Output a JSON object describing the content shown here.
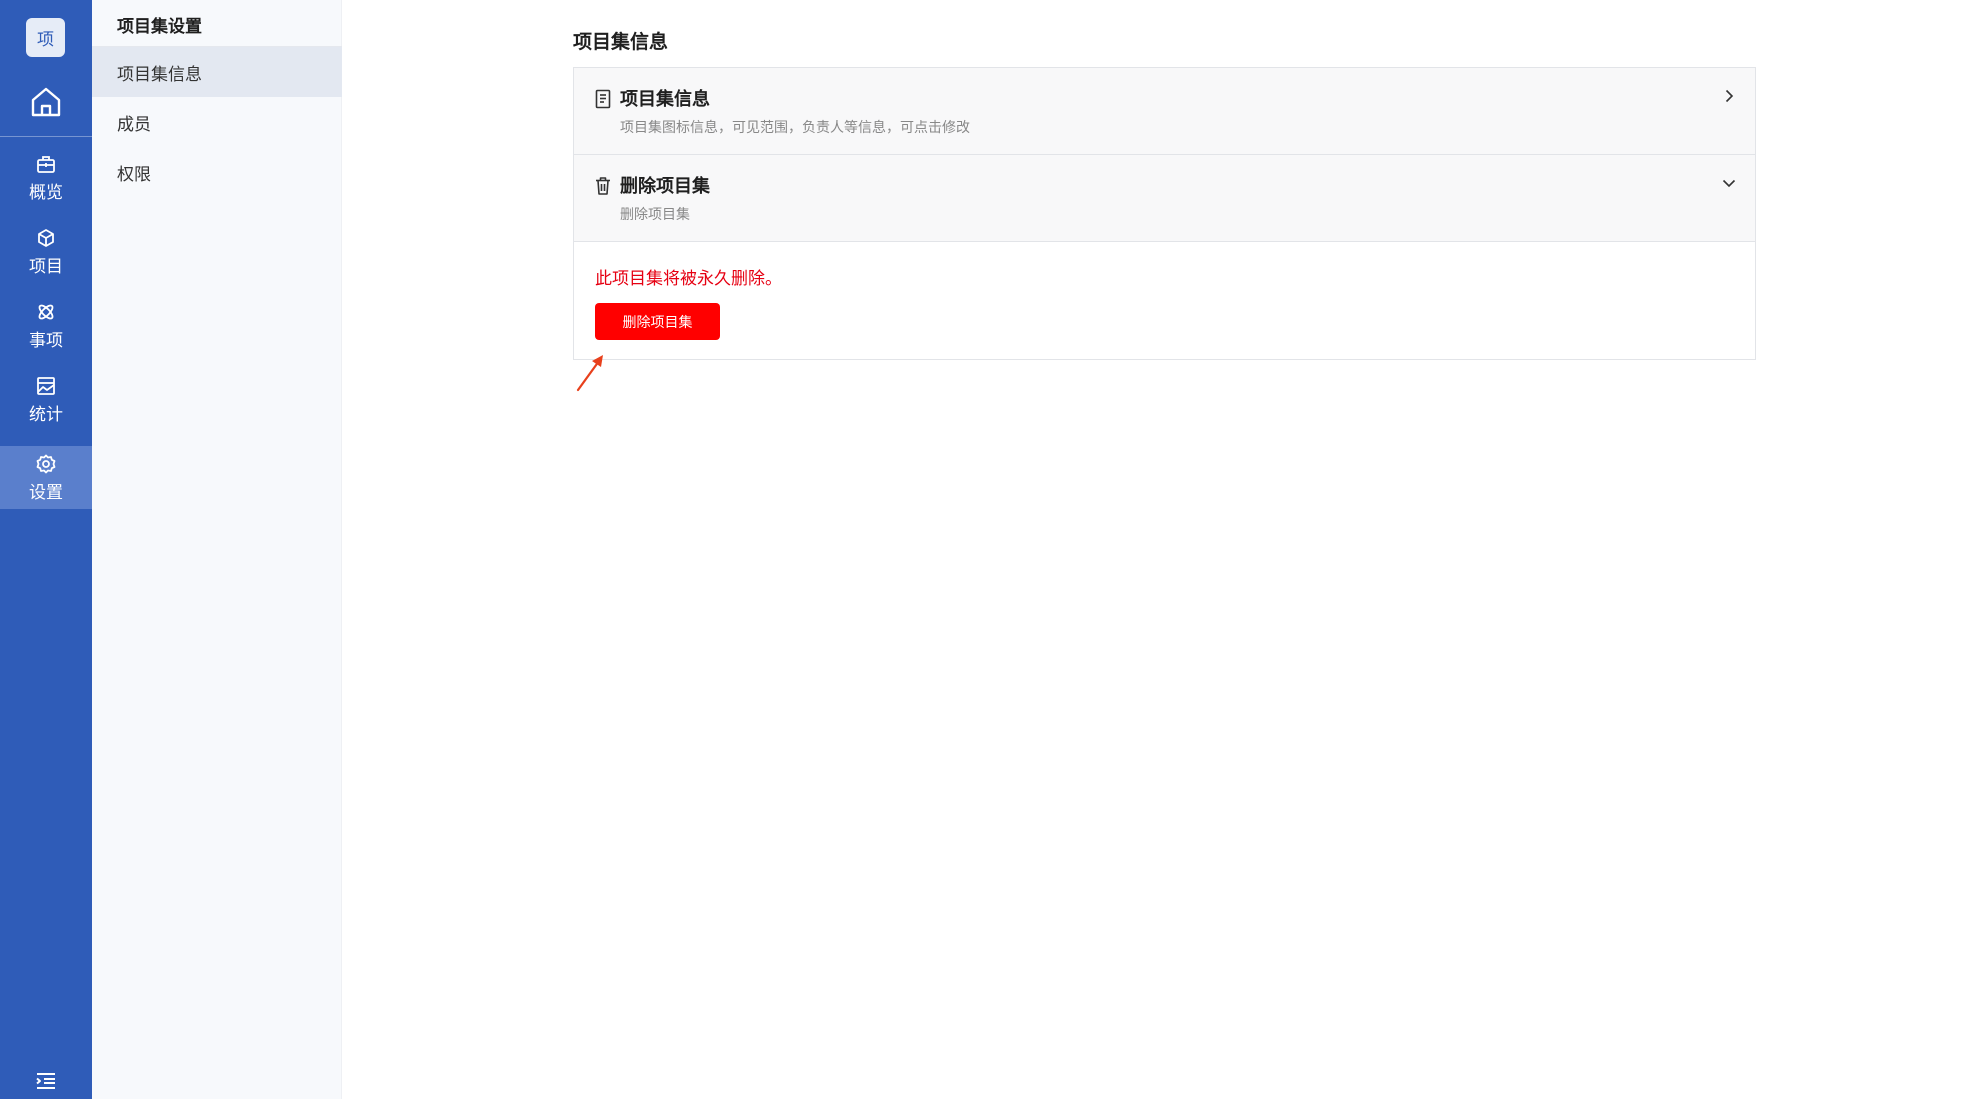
{
  "rail": {
    "logo_text": "项",
    "items": [
      {
        "label": "概览",
        "icon": "briefcase-icon"
      },
      {
        "label": "项目",
        "icon": "cube-icon"
      },
      {
        "label": "事项",
        "icon": "atom-icon"
      },
      {
        "label": "统计",
        "icon": "chart-image-icon"
      },
      {
        "label": "设置",
        "icon": "gear-icon",
        "active": true
      }
    ]
  },
  "subnav": {
    "title": "项目集设置",
    "items": [
      {
        "label": "项目集信息",
        "active": true
      },
      {
        "label": "成员"
      },
      {
        "label": "权限"
      }
    ]
  },
  "main": {
    "title": "项目集信息",
    "rows": [
      {
        "title": "项目集信息",
        "desc": "项目集图标信息，可见范围，负责人等信息，可点击修改",
        "icon": "document-icon",
        "chevron": "chevron-right-icon"
      },
      {
        "title": "删除项目集",
        "desc": "删除项目集",
        "icon": "trash-icon",
        "chevron": "chevron-down-icon"
      }
    ],
    "warning": "此项目集将被永久删除。",
    "delete_button": "删除项目集"
  },
  "colors": {
    "rail_bg": "#2f5cb8",
    "rail_active": "#5a7fcc",
    "danger": "#ff0000",
    "annotation_arrow": "#e8401c"
  }
}
